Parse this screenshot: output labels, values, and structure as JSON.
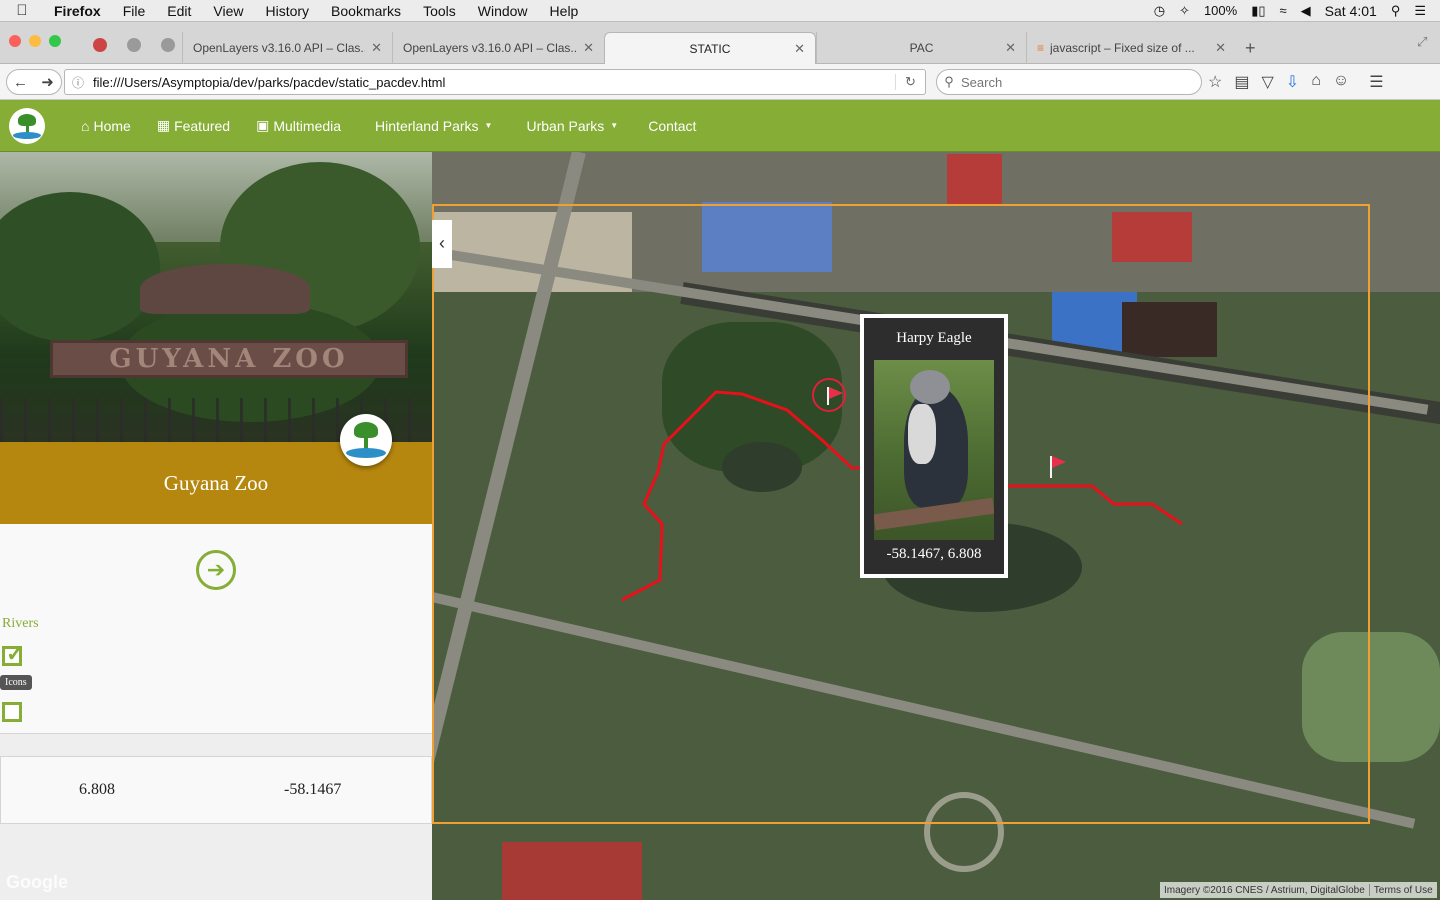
{
  "os_menu": {
    "app": "Firefox",
    "items": [
      "File",
      "Edit",
      "View",
      "History",
      "Bookmarks",
      "Tools",
      "Window",
      "Help"
    ],
    "battery": "100%",
    "clock": "Sat 4:01"
  },
  "tabs": [
    {
      "label": "OpenLayers v3.16.0 API – Clas...",
      "active": false
    },
    {
      "label": "OpenLayers v3.16.0 API – Clas...",
      "active": false
    },
    {
      "label": "STATIC",
      "active": true
    },
    {
      "label": "PAC",
      "active": false
    },
    {
      "label": "javascript – Fixed size of ...",
      "active": false
    }
  ],
  "address_bar": {
    "url": "file:///Users/Asymptopia/dev/parks/pacdev/static_pacdev.html"
  },
  "search": {
    "placeholder": "Search"
  },
  "site_nav": {
    "items": [
      {
        "label": "Home",
        "icon": "home-icon"
      },
      {
        "label": "Featured",
        "icon": "film-icon"
      },
      {
        "label": "Multimedia",
        "icon": "image-icon"
      },
      {
        "label": "Hinterland Parks",
        "dropdown": true
      },
      {
        "label": "Urban Parks",
        "dropdown": true
      },
      {
        "label": "Contact"
      }
    ],
    "bg_color": "#86ad35"
  },
  "park": {
    "sign_text": "GUYANA ZOO",
    "title": "Guyana Zoo",
    "band_color": "#b5870f",
    "rivers_label": "Rivers",
    "rivers_checked": true,
    "icons_tooltip": "Icons",
    "icons_checked": false,
    "lat": "6.808",
    "lon": "-58.1467",
    "google_watermark": "Google"
  },
  "map": {
    "popup_title": "Harpy Eagle",
    "popup_coords": "-58.1467, 6.808",
    "attribution_imagery": "Imagery ©2016 CNES / Astrium, DigitalGlobe",
    "attribution_terms": "Terms of Use",
    "route_color": "#e8101a",
    "extent_color": "#f0a030"
  }
}
